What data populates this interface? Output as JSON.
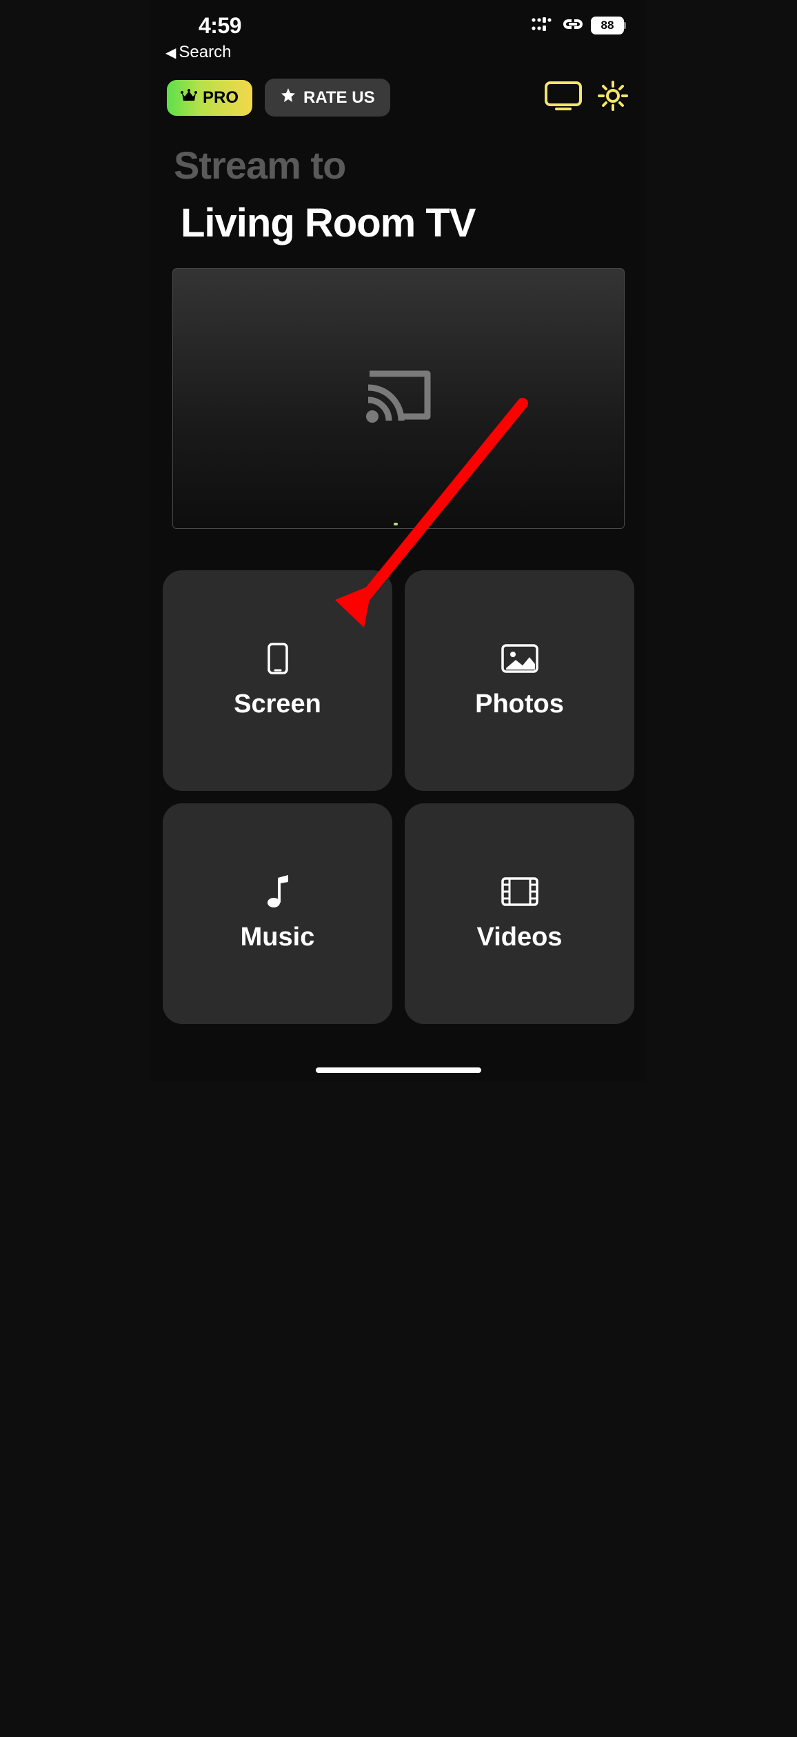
{
  "status": {
    "time": "4:59",
    "battery_pct": "88"
  },
  "nav": {
    "back_label": "Search"
  },
  "toolbar": {
    "pro_label": "PRO",
    "rate_label": "RATE US"
  },
  "title": {
    "top": "Stream to",
    "device": "Living Room TV"
  },
  "tiles": {
    "screen": "Screen",
    "photos": "Photos",
    "music": "Music",
    "videos": "Videos"
  },
  "annotation": {
    "arrow_color": "#ff0000"
  }
}
